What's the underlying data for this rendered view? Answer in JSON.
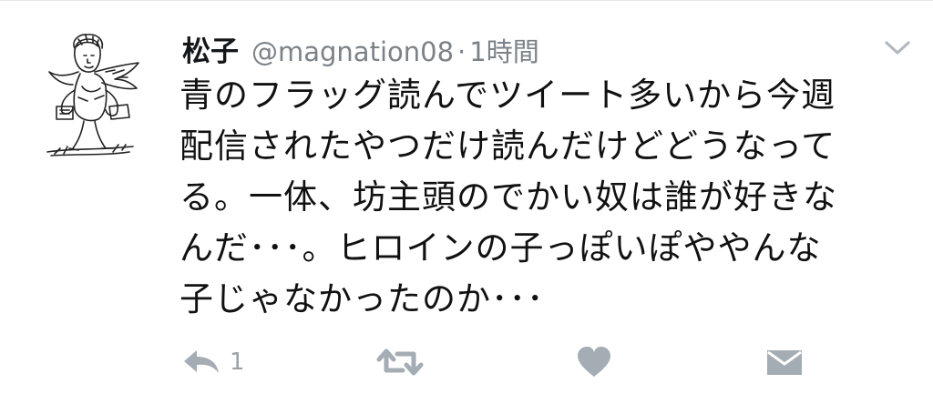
{
  "tweet": {
    "display_name": "松子",
    "handle": "@magnation08",
    "separator": "·",
    "timestamp": "1時間",
    "text_lines": [
      "青のフラッグ読んでツイート多いから今週",
      "配信されたやつだけ読んだけどどうなって",
      "る。一体、坊主頭のでかい奴は誰が好きな",
      "んだ･･･。ヒロインの子っぽいぽややんな",
      "子じゃなかったのか･･･"
    ]
  },
  "actions": {
    "reply": {
      "icon": "reply-icon",
      "count": "1"
    },
    "retweet": {
      "icon": "retweet-icon"
    },
    "like": {
      "icon": "heart-icon"
    },
    "dm": {
      "icon": "envelope-icon"
    }
  },
  "menu": {
    "icon": "chevron-down-icon"
  },
  "colors": {
    "text": "#111111",
    "muted": "#7b8288",
    "icon": "#a4acb4",
    "background": "#ffffff"
  }
}
